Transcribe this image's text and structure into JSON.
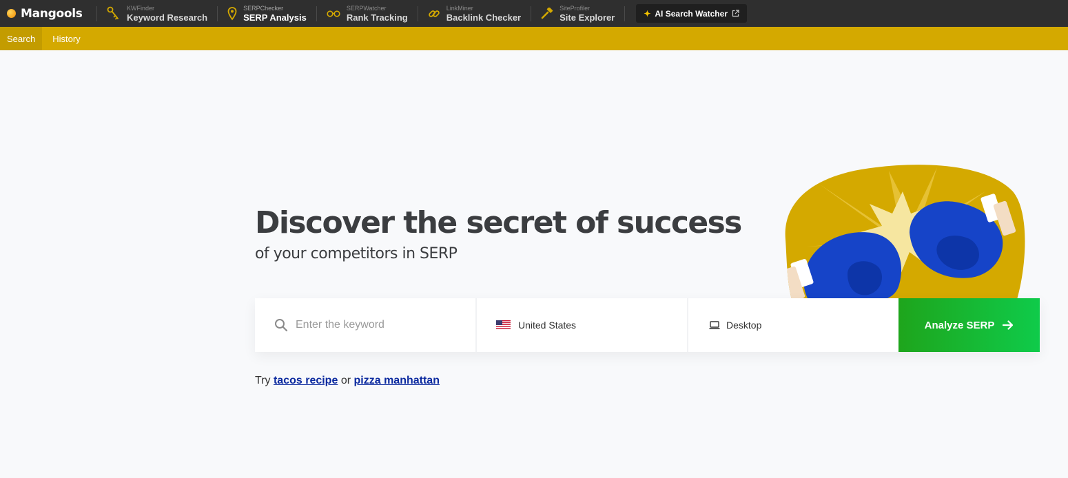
{
  "brand": {
    "name": "Mangools"
  },
  "nav": [
    {
      "small": "KWFinder",
      "main": "Keyword Research",
      "icon": "key-icon"
    },
    {
      "small": "SERPChecker",
      "main": "SERP Analysis",
      "icon": "location-pin-icon",
      "active": true
    },
    {
      "small": "SERPWatcher",
      "main": "Rank Tracking",
      "icon": "glasses-icon"
    },
    {
      "small": "LinkMiner",
      "main": "Backlink Checker",
      "icon": "link-icon"
    },
    {
      "small": "SiteProfiler",
      "main": "Site Explorer",
      "icon": "hammer-icon"
    }
  ],
  "ai_button": {
    "label": "AI Search Watcher"
  },
  "subnav": {
    "search": "Search",
    "history": "History"
  },
  "hero": {
    "title": "Discover the secret of success",
    "subtitle": "of your competitors in SERP"
  },
  "search": {
    "keyword_placeholder": "Enter the keyword",
    "keyword_value": "",
    "country": "United States",
    "device": "Desktop",
    "submit_label": "Analyze SERP"
  },
  "try": {
    "prefix": "Try",
    "example1": "tacos recipe",
    "conjunction": "or",
    "example2": "pizza manhattan"
  },
  "colors": {
    "nav_bg": "#2f2f2f",
    "subnav_bg": "#d4a900",
    "accent_green": "#1ea51c",
    "link_blue": "#0c2a9f"
  }
}
